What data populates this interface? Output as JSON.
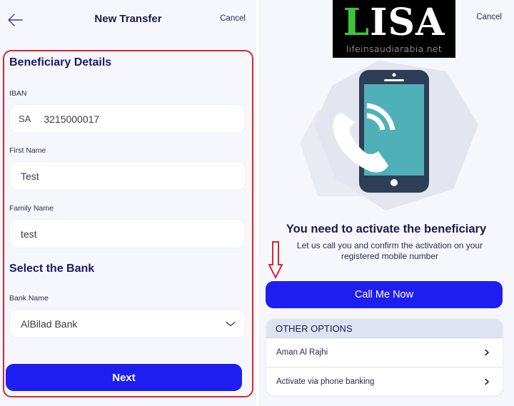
{
  "left": {
    "header": {
      "back_icon": "arrow-left-icon",
      "title": "New Transfer",
      "cancel_label": "Cancel"
    },
    "beneficiary": {
      "section_title": "Beneficiary Details",
      "iban": {
        "label": "IBAN",
        "prefix": "SA",
        "value": "3215000017"
      },
      "first_name": {
        "label": "First Name",
        "value": "Test"
      },
      "family_name": {
        "label": "Family Name",
        "value": "test"
      }
    },
    "bank": {
      "section_title": "Select the Bank",
      "bank_name": {
        "label": "Bank Name",
        "selected": "AlBilad Bank",
        "icon": "chevron-down-icon"
      }
    },
    "next_label": "Next"
  },
  "right": {
    "logo": {
      "letter_l": "L",
      "letters_isa": "ISA",
      "url": "lifeinsaudiarabia.net"
    },
    "cancel_label": "Cancel",
    "illustration": "phone-call-icon",
    "headline": "You need to activate the beneficiary",
    "subtext": "Let us call you and confirm the activation on your registered mobile number",
    "call_label": "Call Me Now",
    "other_options": {
      "title": "OTHER OPTIONS",
      "items": [
        {
          "label": "Aman Al Rajhi",
          "icon": "chevron-right-icon"
        },
        {
          "label": "Activate via phone banking",
          "icon": "chevron-right-icon"
        }
      ]
    }
  },
  "colors": {
    "primary": "#1e1ef0",
    "highlight": "#d9262f",
    "text_dark": "#1b1a4e",
    "logo_green": "#3ec43a",
    "phone_body": "#2d3e56",
    "phone_screen": "#4fb0b8"
  }
}
